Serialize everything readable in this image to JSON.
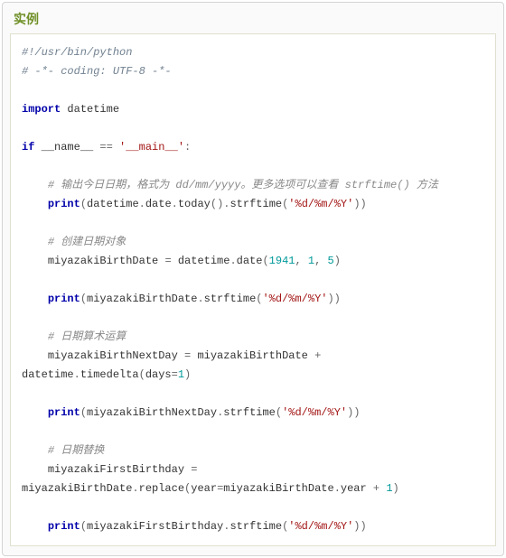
{
  "title": "实例",
  "code_lines": [
    [
      {
        "t": "cmt",
        "v": "#!/usr/bin/python"
      }
    ],
    [
      {
        "t": "cmt",
        "v": "# -*- coding: UTF-8 -*-"
      }
    ],
    [],
    [
      {
        "t": "kw",
        "v": "import"
      },
      {
        "t": "tx",
        "v": " datetime"
      }
    ],
    [],
    [
      {
        "t": "kw",
        "v": "if"
      },
      {
        "t": "tx",
        "v": " __name__ "
      },
      {
        "t": "op",
        "v": "=="
      },
      {
        "t": "tx",
        "v": " "
      },
      {
        "t": "str",
        "v": "'__main__'"
      },
      {
        "t": "op",
        "v": ":"
      }
    ],
    [],
    [
      {
        "t": "tx",
        "v": "    "
      },
      {
        "t": "cmt2",
        "v": "# 输出今日日期，格式为 dd/mm/yyyy。更多选项可以查看 strftime() 方法"
      }
    ],
    [
      {
        "t": "tx",
        "v": "    "
      },
      {
        "t": "kw",
        "v": "print"
      },
      {
        "t": "op",
        "v": "("
      },
      {
        "t": "tx",
        "v": "datetime"
      },
      {
        "t": "op",
        "v": "."
      },
      {
        "t": "tx",
        "v": "date"
      },
      {
        "t": "op",
        "v": "."
      },
      {
        "t": "tx",
        "v": "today"
      },
      {
        "t": "op",
        "v": "()."
      },
      {
        "t": "tx",
        "v": "strftime"
      },
      {
        "t": "op",
        "v": "("
      },
      {
        "t": "str",
        "v": "'%d/%m/%Y'"
      },
      {
        "t": "op",
        "v": "))"
      }
    ],
    [],
    [
      {
        "t": "tx",
        "v": "    "
      },
      {
        "t": "cmt2",
        "v": "# 创建日期对象"
      }
    ],
    [
      {
        "t": "tx",
        "v": "    miyazakiBirthDate "
      },
      {
        "t": "op",
        "v": "="
      },
      {
        "t": "tx",
        "v": " datetime"
      },
      {
        "t": "op",
        "v": "."
      },
      {
        "t": "tx",
        "v": "date"
      },
      {
        "t": "op",
        "v": "("
      },
      {
        "t": "num",
        "v": "1941"
      },
      {
        "t": "op",
        "v": ", "
      },
      {
        "t": "num",
        "v": "1"
      },
      {
        "t": "op",
        "v": ", "
      },
      {
        "t": "num",
        "v": "5"
      },
      {
        "t": "op",
        "v": ")"
      }
    ],
    [],
    [
      {
        "t": "tx",
        "v": "    "
      },
      {
        "t": "kw",
        "v": "print"
      },
      {
        "t": "op",
        "v": "("
      },
      {
        "t": "tx",
        "v": "miyazakiBirthDate"
      },
      {
        "t": "op",
        "v": "."
      },
      {
        "t": "tx",
        "v": "strftime"
      },
      {
        "t": "op",
        "v": "("
      },
      {
        "t": "str",
        "v": "'%d/%m/%Y'"
      },
      {
        "t": "op",
        "v": "))"
      }
    ],
    [],
    [
      {
        "t": "tx",
        "v": "    "
      },
      {
        "t": "cmt2",
        "v": "# 日期算术运算"
      }
    ],
    [
      {
        "t": "tx",
        "v": "    miyazakiBirthNextDay "
      },
      {
        "t": "op",
        "v": "="
      },
      {
        "t": "tx",
        "v": " miyazakiBirthDate "
      },
      {
        "t": "op",
        "v": "+"
      },
      {
        "t": "tx",
        "v": " datetime"
      },
      {
        "t": "op",
        "v": "."
      },
      {
        "t": "tx",
        "v": "timedelta"
      },
      {
        "t": "op",
        "v": "("
      },
      {
        "t": "tx",
        "v": "days"
      },
      {
        "t": "op",
        "v": "="
      },
      {
        "t": "num",
        "v": "1"
      },
      {
        "t": "op",
        "v": ")"
      }
    ],
    [],
    [
      {
        "t": "tx",
        "v": "    "
      },
      {
        "t": "kw",
        "v": "print"
      },
      {
        "t": "op",
        "v": "("
      },
      {
        "t": "tx",
        "v": "miyazakiBirthNextDay"
      },
      {
        "t": "op",
        "v": "."
      },
      {
        "t": "tx",
        "v": "strftime"
      },
      {
        "t": "op",
        "v": "("
      },
      {
        "t": "str",
        "v": "'%d/%m/%Y'"
      },
      {
        "t": "op",
        "v": "))"
      }
    ],
    [],
    [
      {
        "t": "tx",
        "v": "    "
      },
      {
        "t": "cmt2",
        "v": "# 日期替换"
      }
    ],
    [
      {
        "t": "tx",
        "v": "    miyazakiFirstBirthday "
      },
      {
        "t": "op",
        "v": "="
      },
      {
        "t": "tx",
        "v": " miyazakiBirthDate"
      },
      {
        "t": "op",
        "v": "."
      },
      {
        "t": "tx",
        "v": "replace"
      },
      {
        "t": "op",
        "v": "("
      },
      {
        "t": "tx",
        "v": "year"
      },
      {
        "t": "op",
        "v": "="
      },
      {
        "t": "tx",
        "v": "miyazakiBirthDate"
      },
      {
        "t": "op",
        "v": "."
      },
      {
        "t": "tx",
        "v": "year "
      },
      {
        "t": "op",
        "v": "+"
      },
      {
        "t": "tx",
        "v": " "
      },
      {
        "t": "num",
        "v": "1"
      },
      {
        "t": "op",
        "v": ")"
      }
    ],
    [],
    [
      {
        "t": "tx",
        "v": "    "
      },
      {
        "t": "kw",
        "v": "print"
      },
      {
        "t": "op",
        "v": "("
      },
      {
        "t": "tx",
        "v": "miyazakiFirstBirthday"
      },
      {
        "t": "op",
        "v": "."
      },
      {
        "t": "tx",
        "v": "strftime"
      },
      {
        "t": "op",
        "v": "("
      },
      {
        "t": "str",
        "v": "'%d/%m/%Y'"
      },
      {
        "t": "op",
        "v": "))"
      }
    ]
  ]
}
